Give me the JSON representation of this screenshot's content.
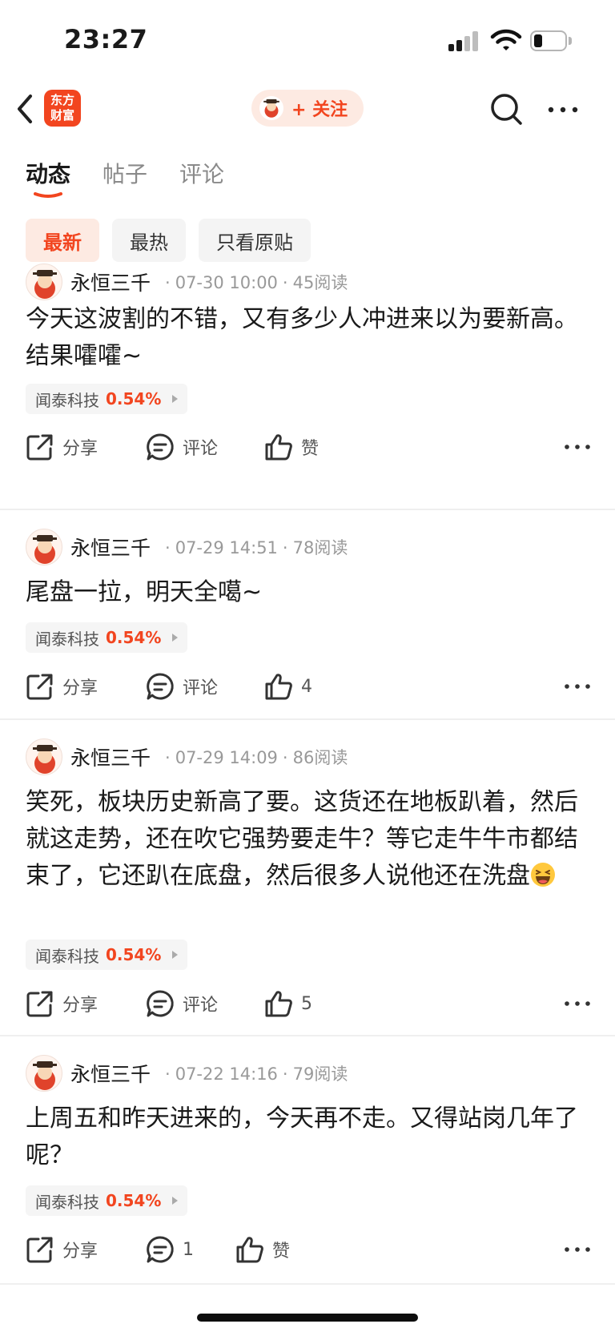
{
  "status_bar": {
    "time": "23:27"
  },
  "nav": {
    "logo_line1": "东方",
    "logo_line2": "财富",
    "follow_label": "+ 关注"
  },
  "tabs": [
    "动态",
    "帖子",
    "评论"
  ],
  "filters": [
    "最新",
    "最热",
    "只看原贴"
  ],
  "posts": [
    {
      "author": "永恒三千",
      "date": "07-30 10:00",
      "reads": "45阅读",
      "text": "今天这波割的不错，又有多少人冲进来以为要新高。结果嚯嚯~",
      "stock_name": "闻泰科技",
      "stock_pct": "0.54%",
      "share_label": "分享",
      "comment_label": "评论",
      "like_label": "赞"
    },
    {
      "author": "永恒三千",
      "date": "07-29 14:51",
      "reads": "78阅读",
      "text": "尾盘一拉，明天全噶~",
      "stock_name": "闻泰科技",
      "stock_pct": "0.54%",
      "share_label": "分享",
      "comment_label": "评论",
      "like_label": "4"
    },
    {
      "author": "永恒三千",
      "date": "07-29 14:09",
      "reads": "86阅读",
      "text": "笑死，板块历史新高了要。这货还在地板趴着，然后就这走势，还在吹它强势要走牛？等它走牛牛市都结束了，它还趴在底盘，然后很多人说他还在洗盘",
      "stock_name": "闻泰科技",
      "stock_pct": "0.54%",
      "share_label": "分享",
      "comment_label": "评论",
      "like_label": "5"
    },
    {
      "author": "永恒三千",
      "date": "07-22 14:16",
      "reads": "79阅读",
      "text": "上周五和昨天进来的，今天再不走。又得站岗几年了呢？",
      "stock_name": "闻泰科技",
      "stock_pct": "0.54%",
      "share_label": "分享",
      "comment_label": "1",
      "like_label": "赞"
    }
  ],
  "colors": {
    "accent": "#f2451f",
    "accent_bg": "#fdeae2"
  }
}
